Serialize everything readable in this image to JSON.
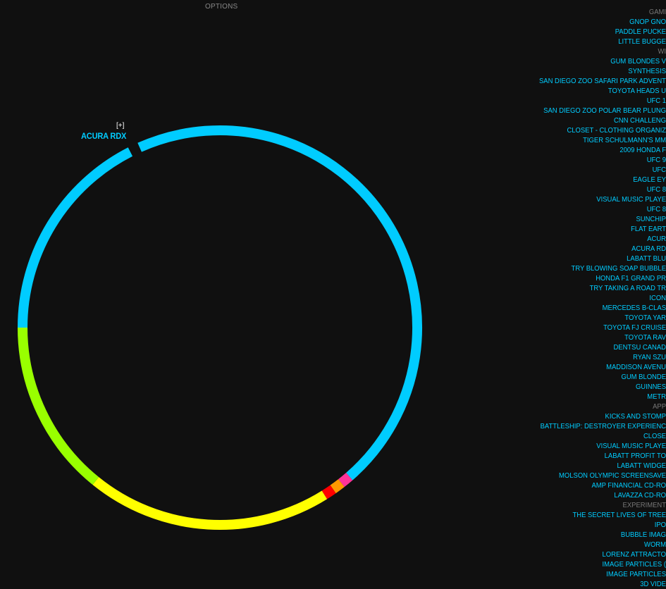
{
  "header": {
    "options_label": "OPTIONS"
  },
  "selection": {
    "label": "ACURA RDX",
    "expand_label": "[+]"
  },
  "ring": {
    "colors": {
      "web": "#00ccff",
      "games": "#99ff00",
      "apps": "#ffff00",
      "red": "#ff0000",
      "orange": "#ff9900",
      "pink": "#ff3399"
    },
    "segments": [
      {
        "color": "#00ccff",
        "start_deg": 336,
        "end_deg": 499
      },
      {
        "color": "#ff3399",
        "start_deg": 139,
        "end_deg": 142
      },
      {
        "color": "#ff9900",
        "start_deg": 142,
        "end_deg": 145
      },
      {
        "color": "#ff0000",
        "start_deg": 145,
        "end_deg": 148
      },
      {
        "color": "#ffff00",
        "start_deg": 148,
        "end_deg": 219
      },
      {
        "color": "#99ff00",
        "start_deg": 219,
        "end_deg": 270
      },
      {
        "color": "#00ccff",
        "start_deg": 270,
        "end_deg": 333
      }
    ]
  },
  "list": {
    "items": [
      {
        "label": "GAMI",
        "category": true
      },
      {
        "label": "GNOP GNO"
      },
      {
        "label": "PADDLE PUCKE"
      },
      {
        "label": "LITTLE BUGGE"
      },
      {
        "label": "WI",
        "category": true
      },
      {
        "label": "GUM BLONDES V"
      },
      {
        "label": "SYNTHESIS"
      },
      {
        "label": "SAN DIEGO ZOO SAFARI PARK ADVENTUR"
      },
      {
        "label": "TOYOTA HEADS U"
      },
      {
        "label": "UFC 1"
      },
      {
        "label": "SAN DIEGO ZOO POLAR BEAR PLUNG"
      },
      {
        "label": "CNN CHALLENG"
      },
      {
        "label": "CLOSET - CLOTHING ORGANIZ"
      },
      {
        "label": "TIGER SCHULMANN'S MM"
      },
      {
        "label": "2009 HONDA F"
      },
      {
        "label": "UFC 9"
      },
      {
        "label": "UFC"
      },
      {
        "label": "EAGLE EY"
      },
      {
        "label": "UFC 8"
      },
      {
        "label": "VISUAL MUSIC PLAYE"
      },
      {
        "label": "UFC 8"
      },
      {
        "label": "SUNCHIP"
      },
      {
        "label": "FLAT EART"
      },
      {
        "label": "ACUR"
      },
      {
        "label": "ACURA RD"
      },
      {
        "label": "LABATT BLU"
      },
      {
        "label": "TRY BLOWING SOAP BUBBLE"
      },
      {
        "label": "HONDA F1 GRAND PR"
      },
      {
        "label": "TRY TAKING A ROAD TR"
      },
      {
        "label": "ICON"
      },
      {
        "label": "MERCEDES B-CLAS"
      },
      {
        "label": "TOYOTA YAR"
      },
      {
        "label": "TOYOTA FJ CRUISE"
      },
      {
        "label": "TOYOTA RAV"
      },
      {
        "label": "DENTSU CANAD"
      },
      {
        "label": "RYAN SZU"
      },
      {
        "label": "MADDISON AVENU"
      },
      {
        "label": "GUM BLONDE"
      },
      {
        "label": "GUINNES"
      },
      {
        "label": "METR"
      },
      {
        "label": "APP",
        "category": true
      },
      {
        "label": "KICKS AND STOMP"
      },
      {
        "label": "BATTLESHIP: DESTROYER EXPERIENC"
      },
      {
        "label": "CLOSE"
      },
      {
        "label": "VISUAL MUSIC PLAYE"
      },
      {
        "label": "LABATT PROFIT TO"
      },
      {
        "label": "LABATT WIDGE"
      },
      {
        "label": "MOLSON OLYMPIC SCREENSAVE"
      },
      {
        "label": "AMP FINANCIAL CD-RO"
      },
      {
        "label": "LAVAZZA CD-RO"
      },
      {
        "label": "EXPERIMENT",
        "category": true
      },
      {
        "label": "THE SECRET LIVES OF TREE"
      },
      {
        "label": "IPO"
      },
      {
        "label": "BUBBLE IMAG"
      },
      {
        "label": "WORM"
      },
      {
        "label": "LORENZ ATTRACTO"
      },
      {
        "label": "IMAGE PARTICLES ("
      },
      {
        "label": "IMAGE PARTICLES"
      },
      {
        "label": "3D VIDE"
      }
    ]
  }
}
